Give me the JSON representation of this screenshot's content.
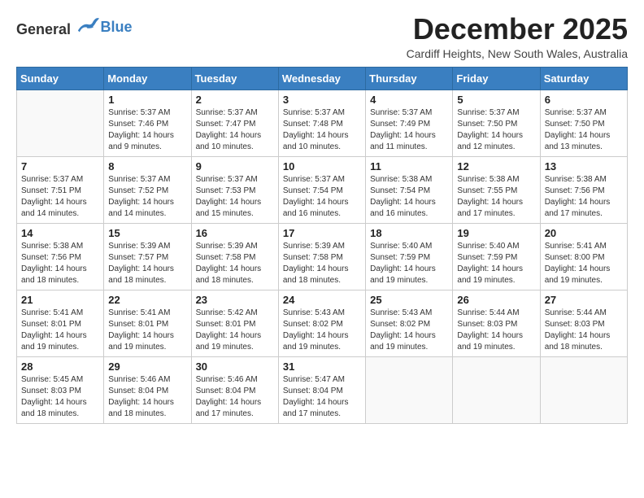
{
  "header": {
    "logo_general": "General",
    "logo_blue": "Blue",
    "month_title": "December 2025",
    "location": "Cardiff Heights, New South Wales, Australia"
  },
  "days_of_week": [
    "Sunday",
    "Monday",
    "Tuesday",
    "Wednesday",
    "Thursday",
    "Friday",
    "Saturday"
  ],
  "weeks": [
    [
      {
        "day": "",
        "sunrise": "",
        "sunset": "",
        "daylight": ""
      },
      {
        "day": "1",
        "sunrise": "Sunrise: 5:37 AM",
        "sunset": "Sunset: 7:46 PM",
        "daylight": "Daylight: 14 hours and 9 minutes."
      },
      {
        "day": "2",
        "sunrise": "Sunrise: 5:37 AM",
        "sunset": "Sunset: 7:47 PM",
        "daylight": "Daylight: 14 hours and 10 minutes."
      },
      {
        "day": "3",
        "sunrise": "Sunrise: 5:37 AM",
        "sunset": "Sunset: 7:48 PM",
        "daylight": "Daylight: 14 hours and 10 minutes."
      },
      {
        "day": "4",
        "sunrise": "Sunrise: 5:37 AM",
        "sunset": "Sunset: 7:49 PM",
        "daylight": "Daylight: 14 hours and 11 minutes."
      },
      {
        "day": "5",
        "sunrise": "Sunrise: 5:37 AM",
        "sunset": "Sunset: 7:50 PM",
        "daylight": "Daylight: 14 hours and 12 minutes."
      },
      {
        "day": "6",
        "sunrise": "Sunrise: 5:37 AM",
        "sunset": "Sunset: 7:50 PM",
        "daylight": "Daylight: 14 hours and 13 minutes."
      }
    ],
    [
      {
        "day": "7",
        "sunrise": "Sunrise: 5:37 AM",
        "sunset": "Sunset: 7:51 PM",
        "daylight": "Daylight: 14 hours and 14 minutes."
      },
      {
        "day": "8",
        "sunrise": "Sunrise: 5:37 AM",
        "sunset": "Sunset: 7:52 PM",
        "daylight": "Daylight: 14 hours and 14 minutes."
      },
      {
        "day": "9",
        "sunrise": "Sunrise: 5:37 AM",
        "sunset": "Sunset: 7:53 PM",
        "daylight": "Daylight: 14 hours and 15 minutes."
      },
      {
        "day": "10",
        "sunrise": "Sunrise: 5:37 AM",
        "sunset": "Sunset: 7:54 PM",
        "daylight": "Daylight: 14 hours and 16 minutes."
      },
      {
        "day": "11",
        "sunrise": "Sunrise: 5:38 AM",
        "sunset": "Sunset: 7:54 PM",
        "daylight": "Daylight: 14 hours and 16 minutes."
      },
      {
        "day": "12",
        "sunrise": "Sunrise: 5:38 AM",
        "sunset": "Sunset: 7:55 PM",
        "daylight": "Daylight: 14 hours and 17 minutes."
      },
      {
        "day": "13",
        "sunrise": "Sunrise: 5:38 AM",
        "sunset": "Sunset: 7:56 PM",
        "daylight": "Daylight: 14 hours and 17 minutes."
      }
    ],
    [
      {
        "day": "14",
        "sunrise": "Sunrise: 5:38 AM",
        "sunset": "Sunset: 7:56 PM",
        "daylight": "Daylight: 14 hours and 18 minutes."
      },
      {
        "day": "15",
        "sunrise": "Sunrise: 5:39 AM",
        "sunset": "Sunset: 7:57 PM",
        "daylight": "Daylight: 14 hours and 18 minutes."
      },
      {
        "day": "16",
        "sunrise": "Sunrise: 5:39 AM",
        "sunset": "Sunset: 7:58 PM",
        "daylight": "Daylight: 14 hours and 18 minutes."
      },
      {
        "day": "17",
        "sunrise": "Sunrise: 5:39 AM",
        "sunset": "Sunset: 7:58 PM",
        "daylight": "Daylight: 14 hours and 18 minutes."
      },
      {
        "day": "18",
        "sunrise": "Sunrise: 5:40 AM",
        "sunset": "Sunset: 7:59 PM",
        "daylight": "Daylight: 14 hours and 19 minutes."
      },
      {
        "day": "19",
        "sunrise": "Sunrise: 5:40 AM",
        "sunset": "Sunset: 7:59 PM",
        "daylight": "Daylight: 14 hours and 19 minutes."
      },
      {
        "day": "20",
        "sunrise": "Sunrise: 5:41 AM",
        "sunset": "Sunset: 8:00 PM",
        "daylight": "Daylight: 14 hours and 19 minutes."
      }
    ],
    [
      {
        "day": "21",
        "sunrise": "Sunrise: 5:41 AM",
        "sunset": "Sunset: 8:01 PM",
        "daylight": "Daylight: 14 hours and 19 minutes."
      },
      {
        "day": "22",
        "sunrise": "Sunrise: 5:41 AM",
        "sunset": "Sunset: 8:01 PM",
        "daylight": "Daylight: 14 hours and 19 minutes."
      },
      {
        "day": "23",
        "sunrise": "Sunrise: 5:42 AM",
        "sunset": "Sunset: 8:01 PM",
        "daylight": "Daylight: 14 hours and 19 minutes."
      },
      {
        "day": "24",
        "sunrise": "Sunrise: 5:43 AM",
        "sunset": "Sunset: 8:02 PM",
        "daylight": "Daylight: 14 hours and 19 minutes."
      },
      {
        "day": "25",
        "sunrise": "Sunrise: 5:43 AM",
        "sunset": "Sunset: 8:02 PM",
        "daylight": "Daylight: 14 hours and 19 minutes."
      },
      {
        "day": "26",
        "sunrise": "Sunrise: 5:44 AM",
        "sunset": "Sunset: 8:03 PM",
        "daylight": "Daylight: 14 hours and 19 minutes."
      },
      {
        "day": "27",
        "sunrise": "Sunrise: 5:44 AM",
        "sunset": "Sunset: 8:03 PM",
        "daylight": "Daylight: 14 hours and 18 minutes."
      }
    ],
    [
      {
        "day": "28",
        "sunrise": "Sunrise: 5:45 AM",
        "sunset": "Sunset: 8:03 PM",
        "daylight": "Daylight: 14 hours and 18 minutes."
      },
      {
        "day": "29",
        "sunrise": "Sunrise: 5:46 AM",
        "sunset": "Sunset: 8:04 PM",
        "daylight": "Daylight: 14 hours and 18 minutes."
      },
      {
        "day": "30",
        "sunrise": "Sunrise: 5:46 AM",
        "sunset": "Sunset: 8:04 PM",
        "daylight": "Daylight: 14 hours and 17 minutes."
      },
      {
        "day": "31",
        "sunrise": "Sunrise: 5:47 AM",
        "sunset": "Sunset: 8:04 PM",
        "daylight": "Daylight: 14 hours and 17 minutes."
      },
      {
        "day": "",
        "sunrise": "",
        "sunset": "",
        "daylight": ""
      },
      {
        "day": "",
        "sunrise": "",
        "sunset": "",
        "daylight": ""
      },
      {
        "day": "",
        "sunrise": "",
        "sunset": "",
        "daylight": ""
      }
    ]
  ]
}
